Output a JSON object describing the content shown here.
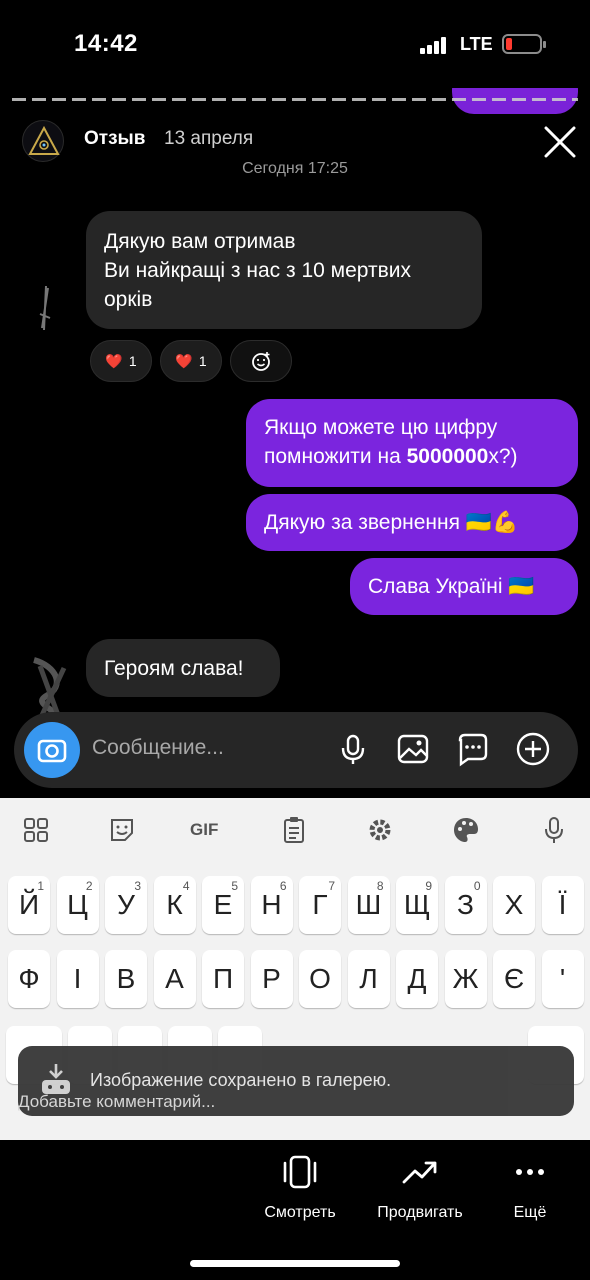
{
  "status_bar": {
    "time": "14:42",
    "network": "LTE"
  },
  "story": {
    "author": "Отзыв",
    "date": "13 апреля"
  },
  "chat": {
    "timestamp": "Сегодня 17:25",
    "messages": [
      {
        "side": "incoming",
        "text": "Дякую вам отримав\nВи найкращі з нас з 10 мертвих орків"
      },
      {
        "side": "outgoing",
        "text_before": "Якщо можете цю цифру помножити на ",
        "bold": "5000000",
        "text_after": "х?)"
      },
      {
        "side": "outgoing",
        "text": "Дякую за звернення 🇺🇦💪"
      },
      {
        "side": "outgoing",
        "text": "Слава Україні 🇺🇦"
      },
      {
        "side": "incoming",
        "text": "Героям слава!"
      }
    ],
    "reactions": [
      {
        "emoji": "❤️",
        "count": "1"
      },
      {
        "emoji": "❤️",
        "count": "1"
      }
    ],
    "composer_placeholder": "Сообщение..."
  },
  "keyboard": {
    "row1": [
      {
        "key": "Й",
        "hint": "1"
      },
      {
        "key": "Ц",
        "hint": "2"
      },
      {
        "key": "У",
        "hint": "3"
      },
      {
        "key": "К",
        "hint": "4"
      },
      {
        "key": "Е",
        "hint": "5"
      },
      {
        "key": "Н",
        "hint": "6"
      },
      {
        "key": "Г",
        "hint": "7"
      },
      {
        "key": "Ш",
        "hint": "8"
      },
      {
        "key": "Щ",
        "hint": "9"
      },
      {
        "key": "З",
        "hint": "0"
      },
      {
        "key": "Х",
        "hint": ""
      },
      {
        "key": "Ї",
        "hint": ""
      }
    ],
    "row2": [
      "Ф",
      "І",
      "В",
      "А",
      "П",
      "Р",
      "О",
      "Л",
      "Д",
      "Ж",
      "Є",
      "'"
    ],
    "tools": [
      "apps-icon",
      "sticker-icon",
      "gif",
      "clipboard-icon",
      "settings-icon",
      "palette-icon",
      "mic-icon"
    ],
    "gif_label": "GIF"
  },
  "toast": {
    "text": "Изображение сохранено в галерею.",
    "comment_hint": "Добавьте комментарий..."
  },
  "actions": [
    {
      "icon": "view-icon",
      "label": "Смотреть"
    },
    {
      "icon": "promote-icon",
      "label": "Продвигать"
    },
    {
      "icon": "more-icon",
      "label": "Ещё"
    }
  ],
  "colors": {
    "outgoing": "#7b25de",
    "incoming": "#262626",
    "camera": "#3797f0"
  }
}
